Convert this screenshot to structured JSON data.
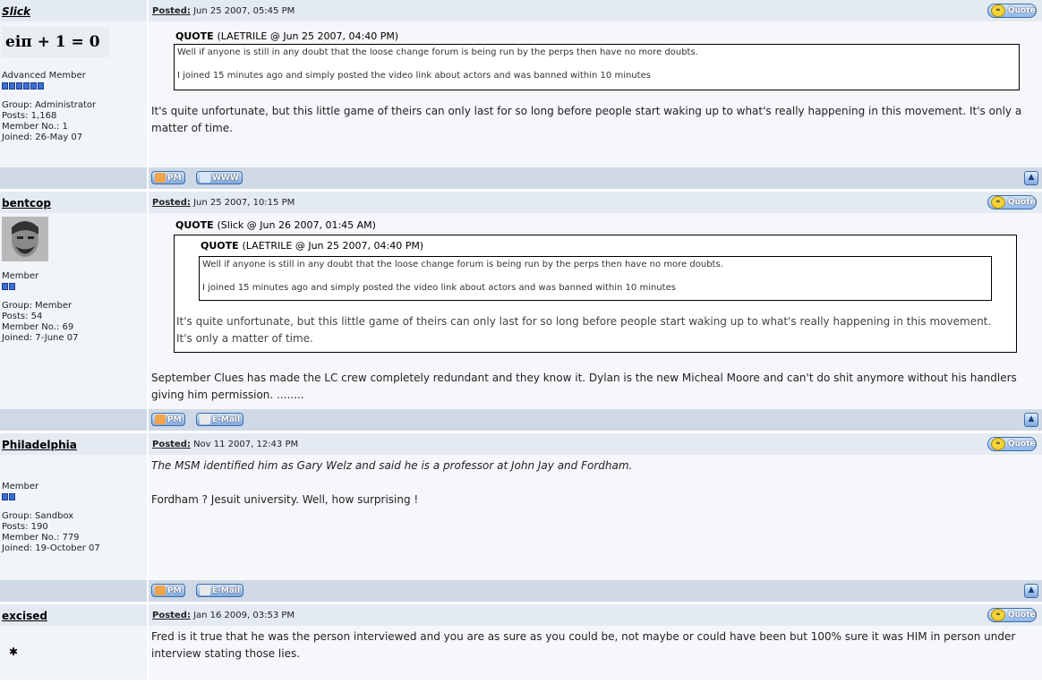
{
  "ui": {
    "quote_label": "Quote",
    "pm_label": "PM",
    "www_label": "WWW",
    "email_label": "E-Mail",
    "posted_label": "Posted:"
  },
  "posts": [
    {
      "author": "Slick",
      "avatar_text": "eiπ + 1 = 0",
      "rank": "Advanced Member",
      "group": "Group: Administrator",
      "posts": "Posts: 1,168",
      "member_no": "Member No.: 1",
      "joined": "Joined: 26-May 07",
      "date": "Jun 25 2007, 05:45 PM",
      "quote_header": "QUOTE",
      "quote_source": "(LAETRILE @ Jun 25 2007, 04:40 PM)",
      "quote_line1": "Well if anyone is still in any doubt that the loose change forum is being run by the perps then have no more doubts.",
      "quote_line2": "I joined 15 minutes ago and simply posted the video link about actors and was banned within 10 minutes",
      "text": "It's quite unfortunate, but this little game of theirs can only last for so long before people start waking up to what's really happening in this movement. It's only a matter of time."
    },
    {
      "author": "bentcop",
      "rank": "Member",
      "group": "Group: Member",
      "posts": "Posts: 54",
      "member_no": "Member No.: 69",
      "joined": "Joined: 7-June 07",
      "date": "Jun 25 2007, 10:15 PM",
      "outer_quote_header": "QUOTE",
      "outer_quote_source": "(Slick @ Jun 26 2007, 01:45 AM)",
      "inner_quote_header": "QUOTE",
      "inner_quote_source": "(LAETRILE @ Jun 25 2007, 04:40 PM)",
      "inner_line1": "Well if anyone is still in any doubt that the loose change forum is being run by the perps then have no more doubts.",
      "inner_line2": "I joined 15 minutes ago and simply posted the video link about actors and was banned within 10 minutes",
      "outer_text": "It's quite unfortunate, but this little game of theirs can only last for so long before people start waking up to what's really happening in this movement. It's only a matter of time.",
      "text": "September Clues has made the LC crew completely redundant and they know it. Dylan is the new Micheal Moore and can't do shit anymore without his handlers giving him permission. ........"
    },
    {
      "author": "Philadelphia",
      "rank": "Member",
      "group": "Group: Sandbox",
      "posts": "Posts: 190",
      "member_no": "Member No.: 779",
      "joined": "Joined: 19-October 07",
      "date": "Nov 11 2007, 12:43 PM",
      "italic_text": "The MSM identified him as Gary Welz and said he is a professor at John Jay and Fordham.",
      "text": "Fordham ? Jesuit university. Well, how surprising !"
    },
    {
      "author": "excised",
      "date": "Jan 16 2009, 03:53 PM",
      "text": "Fred is it true that he was the person interviewed and you are as sure as you could be, not maybe or could have been but 100% sure it was HIM in person under interview stating those lies."
    }
  ]
}
